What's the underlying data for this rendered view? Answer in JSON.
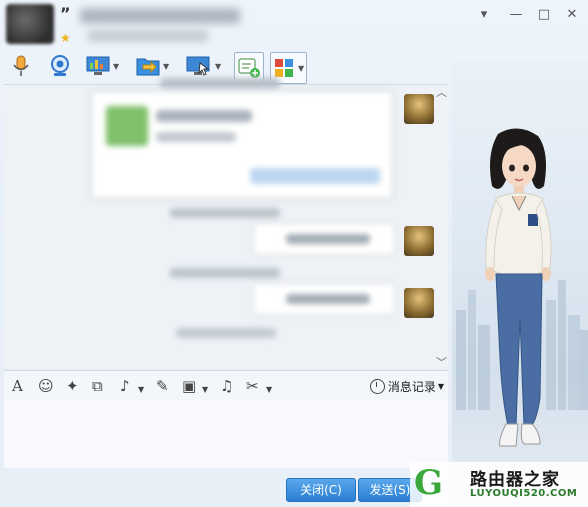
{
  "header": {
    "quote_mark": "”"
  },
  "window": {
    "minimize_glyph": "▾",
    "restore_glyph": "—",
    "maximize_glyph": "□",
    "close_glyph": "✕"
  },
  "toolbar": {
    "icons": [
      "microphone-icon",
      "webcam-icon",
      "screen-share-icon",
      "file-transfer-icon",
      "remote-desktop-icon",
      "app-add-icon",
      "apps-grid-icon"
    ]
  },
  "input_toolbar": {
    "font_glyph": "A",
    "emoji_glyph": "☺",
    "magic_glyph": "✦",
    "screenshot_glyph": "⧉",
    "voice_glyph": "♪",
    "edit_glyph": "✎",
    "image_glyph": "▣",
    "music_glyph": "♫",
    "scissors_glyph": "✂",
    "history_label": "消息记录"
  },
  "buttons": {
    "close_label": "关闭(C)",
    "send_label": "发送(S)"
  },
  "watermark": {
    "title": "路由器之家",
    "url": "LUYOUQI520.COM"
  },
  "colors": {
    "accent": "#2a7fd2",
    "star": "#f2b01e"
  }
}
